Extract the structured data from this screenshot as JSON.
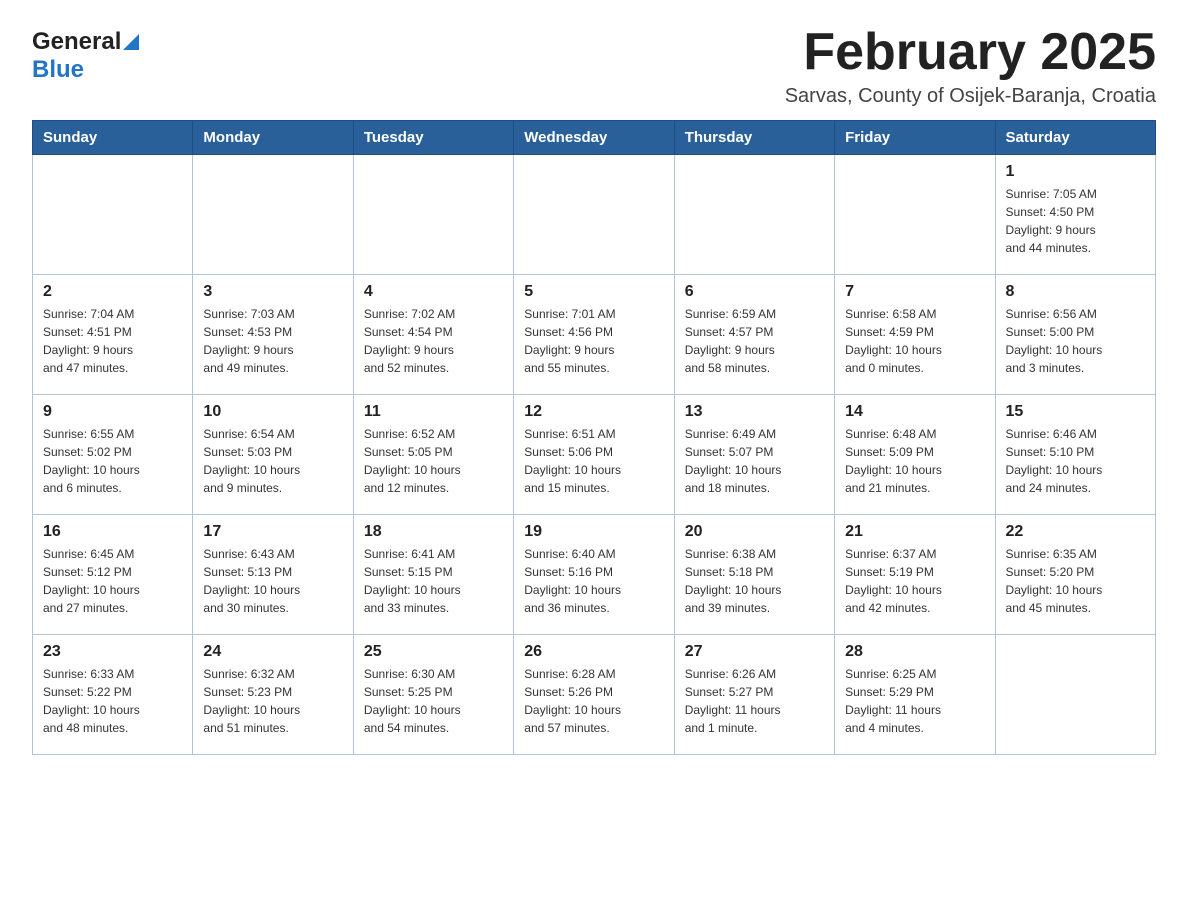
{
  "header": {
    "logo_general": "General",
    "logo_blue": "Blue",
    "month_title": "February 2025",
    "subtitle": "Sarvas, County of Osijek-Baranja, Croatia"
  },
  "weekdays": [
    "Sunday",
    "Monday",
    "Tuesday",
    "Wednesday",
    "Thursday",
    "Friday",
    "Saturday"
  ],
  "weeks": [
    [
      {
        "day": "",
        "info": ""
      },
      {
        "day": "",
        "info": ""
      },
      {
        "day": "",
        "info": ""
      },
      {
        "day": "",
        "info": ""
      },
      {
        "day": "",
        "info": ""
      },
      {
        "day": "",
        "info": ""
      },
      {
        "day": "1",
        "info": "Sunrise: 7:05 AM\nSunset: 4:50 PM\nDaylight: 9 hours\nand 44 minutes."
      }
    ],
    [
      {
        "day": "2",
        "info": "Sunrise: 7:04 AM\nSunset: 4:51 PM\nDaylight: 9 hours\nand 47 minutes."
      },
      {
        "day": "3",
        "info": "Sunrise: 7:03 AM\nSunset: 4:53 PM\nDaylight: 9 hours\nand 49 minutes."
      },
      {
        "day": "4",
        "info": "Sunrise: 7:02 AM\nSunset: 4:54 PM\nDaylight: 9 hours\nand 52 minutes."
      },
      {
        "day": "5",
        "info": "Sunrise: 7:01 AM\nSunset: 4:56 PM\nDaylight: 9 hours\nand 55 minutes."
      },
      {
        "day": "6",
        "info": "Sunrise: 6:59 AM\nSunset: 4:57 PM\nDaylight: 9 hours\nand 58 minutes."
      },
      {
        "day": "7",
        "info": "Sunrise: 6:58 AM\nSunset: 4:59 PM\nDaylight: 10 hours\nand 0 minutes."
      },
      {
        "day": "8",
        "info": "Sunrise: 6:56 AM\nSunset: 5:00 PM\nDaylight: 10 hours\nand 3 minutes."
      }
    ],
    [
      {
        "day": "9",
        "info": "Sunrise: 6:55 AM\nSunset: 5:02 PM\nDaylight: 10 hours\nand 6 minutes."
      },
      {
        "day": "10",
        "info": "Sunrise: 6:54 AM\nSunset: 5:03 PM\nDaylight: 10 hours\nand 9 minutes."
      },
      {
        "day": "11",
        "info": "Sunrise: 6:52 AM\nSunset: 5:05 PM\nDaylight: 10 hours\nand 12 minutes."
      },
      {
        "day": "12",
        "info": "Sunrise: 6:51 AM\nSunset: 5:06 PM\nDaylight: 10 hours\nand 15 minutes."
      },
      {
        "day": "13",
        "info": "Sunrise: 6:49 AM\nSunset: 5:07 PM\nDaylight: 10 hours\nand 18 minutes."
      },
      {
        "day": "14",
        "info": "Sunrise: 6:48 AM\nSunset: 5:09 PM\nDaylight: 10 hours\nand 21 minutes."
      },
      {
        "day": "15",
        "info": "Sunrise: 6:46 AM\nSunset: 5:10 PM\nDaylight: 10 hours\nand 24 minutes."
      }
    ],
    [
      {
        "day": "16",
        "info": "Sunrise: 6:45 AM\nSunset: 5:12 PM\nDaylight: 10 hours\nand 27 minutes."
      },
      {
        "day": "17",
        "info": "Sunrise: 6:43 AM\nSunset: 5:13 PM\nDaylight: 10 hours\nand 30 minutes."
      },
      {
        "day": "18",
        "info": "Sunrise: 6:41 AM\nSunset: 5:15 PM\nDaylight: 10 hours\nand 33 minutes."
      },
      {
        "day": "19",
        "info": "Sunrise: 6:40 AM\nSunset: 5:16 PM\nDaylight: 10 hours\nand 36 minutes."
      },
      {
        "day": "20",
        "info": "Sunrise: 6:38 AM\nSunset: 5:18 PM\nDaylight: 10 hours\nand 39 minutes."
      },
      {
        "day": "21",
        "info": "Sunrise: 6:37 AM\nSunset: 5:19 PM\nDaylight: 10 hours\nand 42 minutes."
      },
      {
        "day": "22",
        "info": "Sunrise: 6:35 AM\nSunset: 5:20 PM\nDaylight: 10 hours\nand 45 minutes."
      }
    ],
    [
      {
        "day": "23",
        "info": "Sunrise: 6:33 AM\nSunset: 5:22 PM\nDaylight: 10 hours\nand 48 minutes."
      },
      {
        "day": "24",
        "info": "Sunrise: 6:32 AM\nSunset: 5:23 PM\nDaylight: 10 hours\nand 51 minutes."
      },
      {
        "day": "25",
        "info": "Sunrise: 6:30 AM\nSunset: 5:25 PM\nDaylight: 10 hours\nand 54 minutes."
      },
      {
        "day": "26",
        "info": "Sunrise: 6:28 AM\nSunset: 5:26 PM\nDaylight: 10 hours\nand 57 minutes."
      },
      {
        "day": "27",
        "info": "Sunrise: 6:26 AM\nSunset: 5:27 PM\nDaylight: 11 hours\nand 1 minute."
      },
      {
        "day": "28",
        "info": "Sunrise: 6:25 AM\nSunset: 5:29 PM\nDaylight: 11 hours\nand 4 minutes."
      },
      {
        "day": "",
        "info": ""
      }
    ]
  ]
}
